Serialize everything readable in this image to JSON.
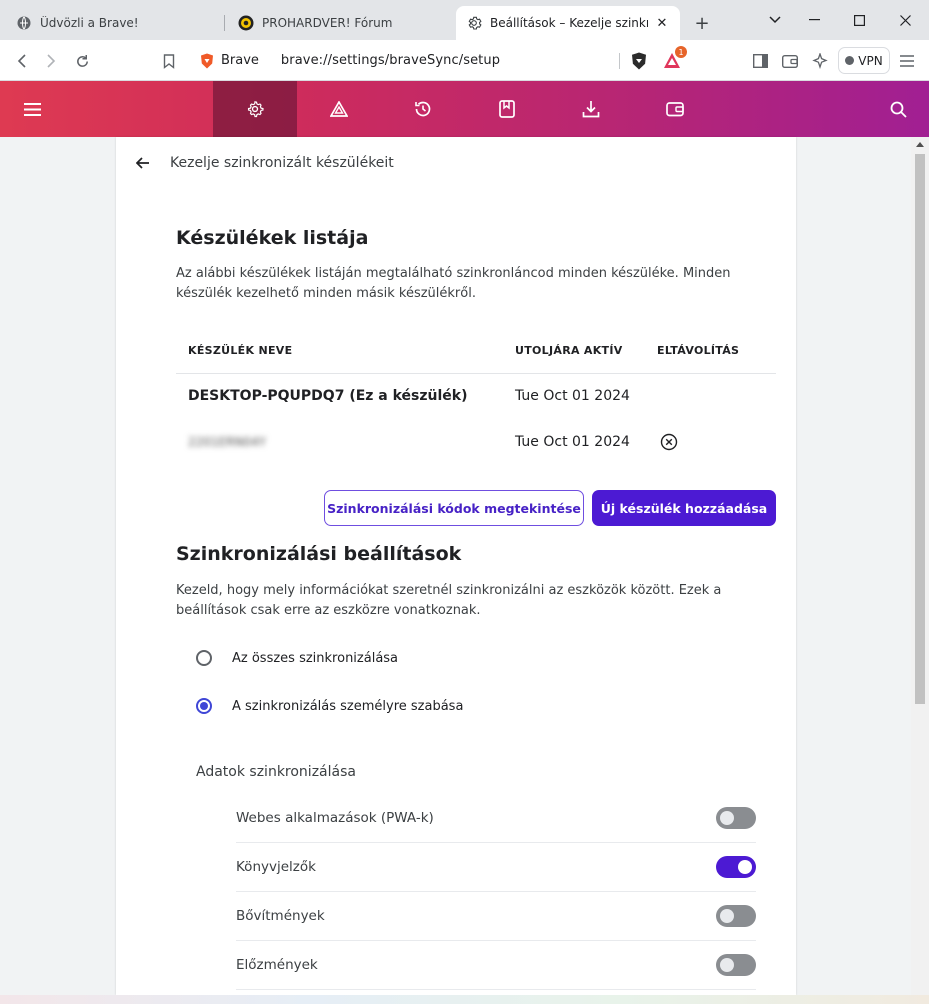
{
  "browser": {
    "tabs": [
      {
        "label": "Üdvözli a Brave!",
        "icon": "brave-icon",
        "active": false
      },
      {
        "label": "PROHARDVER! Fórum",
        "icon": "prohardver-icon",
        "active": false
      },
      {
        "label": "Beállítások – Kezelje szinkroni",
        "icon": "gear-icon",
        "active": true
      }
    ],
    "brand_label": "Brave",
    "url": "brave://settings/braveSync/setup",
    "rewards_badge": "1",
    "vpn_label": "VPN"
  },
  "page": {
    "header_title": "Kezelje szinkronizált készülékeit",
    "devices": {
      "title": "Készülékek listája",
      "description": "Az alábbi készülékek listáján megtalálható szinkronláncod minden készüléke. Minden készülék kezelhető minden másik készülékről.",
      "col_name": "KÉSZÜLÉK NEVE",
      "col_active": "UTOLJÁRA AKTÍV",
      "col_remove": "ELTÁVOLÍTÁS",
      "rows": [
        {
          "name": "DESKTOP-PQUPDQ7 (Ez a készülék)",
          "last_active": "Tue Oct 01 2024"
        },
        {
          "name": "2201ERN04Y",
          "last_active": "Tue Oct 01 2024"
        }
      ],
      "view_codes_button": "Szinkronizálási kódok megtekintése",
      "add_device_button": "Új készülék hozzáadása"
    },
    "sync_settings": {
      "title": "Szinkronizálási beállítások",
      "description": "Kezeld, hogy mely információkat szeretnél szinkronizálni az eszközök között. Ezek a beállítások csak erre az eszközre vonatkoznak.",
      "radio_all": "Az összes szinkronizálása",
      "radio_custom": "A szinkronizálás személyre szabása",
      "selected": "custom",
      "data_heading": "Adatok szinkronizálása",
      "items": [
        {
          "label": "Webes alkalmazások (PWA-k)",
          "enabled": false
        },
        {
          "label": "Könyvjelzők",
          "enabled": true
        },
        {
          "label": "Bővítmények",
          "enabled": false
        },
        {
          "label": "Előzmények",
          "enabled": false
        }
      ]
    }
  },
  "colors": {
    "accent": "#4c1ad3",
    "radio": "#3f46d6",
    "nav_start": "#de3a52",
    "nav_end": "#a11f93"
  }
}
